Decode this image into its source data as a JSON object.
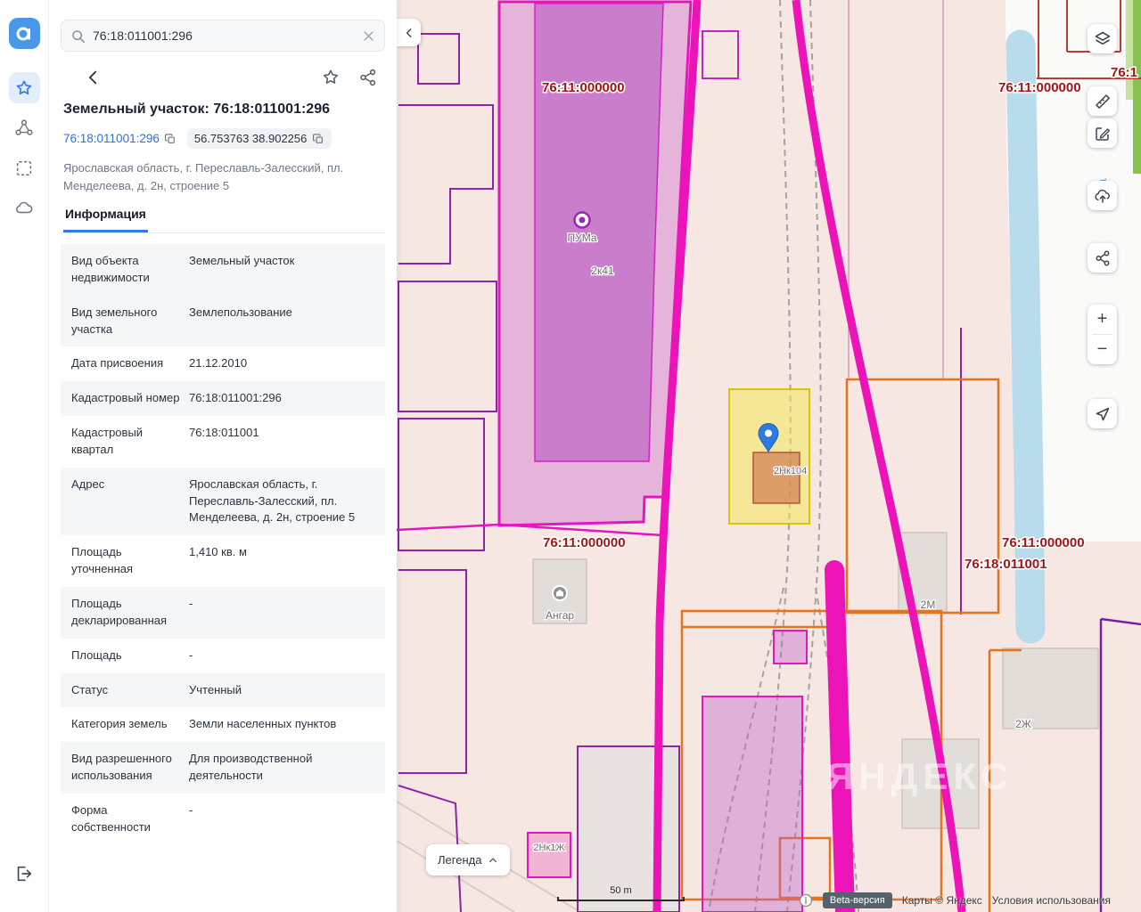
{
  "search": {
    "value": "76:18:011001:296"
  },
  "object": {
    "title": "Земельный участок: 76:18:011001:296",
    "cadastral_number_link": "76:18:011001:296",
    "coordinates": "56.753763 38.902256",
    "address": "Ярославская область, г. Переславль-Залесский, пл. Менделеева, д. 2н, строение 5",
    "tab": "Информация",
    "rows": [
      {
        "label": "Вид объекта недвижимости",
        "value": "Земельный участок"
      },
      {
        "label": "Вид земельного участка",
        "value": "Землепользование"
      },
      {
        "label": "Дата присвоения",
        "value": "21.12.2010"
      },
      {
        "label": "Кадастровый номер",
        "value": "76:18:011001:296"
      },
      {
        "label": "Кадастровый квартал",
        "value": "76:18:011001"
      },
      {
        "label": "Адрес",
        "value": "Ярославская область, г. Переславль-Залесский, пл. Менделеева, д. 2н, строение 5"
      },
      {
        "label": "Площадь уточненная",
        "value": "1,410 кв. м"
      },
      {
        "label": "Площадь декларированная",
        "value": "-"
      },
      {
        "label": "Площадь",
        "value": "-"
      },
      {
        "label": "Статус",
        "value": "Учтенный"
      },
      {
        "label": "Категория земель",
        "value": "Земли населенных пунктов"
      },
      {
        "label": "Вид разрешенного использования",
        "value": "Для производственной деятельности"
      },
      {
        "label": "Форма собственности",
        "value": "-"
      }
    ]
  },
  "map": {
    "quarter_labels": {
      "top_left": "76:11:000000",
      "top_right": "76:11:000000",
      "top_far": "76:1",
      "bottom_left": "76:11:000000",
      "bottom_right": "76:11:000000",
      "parcel": "76:18:011001"
    },
    "object_labels": {
      "puma": "ПУМа",
      "b2k41": "2к41",
      "angar": "Ангар",
      "b2m": "2М",
      "b2zh": "2Ж",
      "b2nk104": "2Нк104",
      "b2nk1zh": "2Нк1Ж"
    },
    "river_label": "тянк",
    "watermark": "ЯНДЕКС",
    "legend": "Легенда",
    "scale": "50 m",
    "zoom_in": "+",
    "zoom_out": "−",
    "beta": "Beta-версия",
    "copyright": "Карты © Яндекс",
    "terms": "Условия использования",
    "colors": {
      "highlight_parcel": "#f6e858",
      "boundary_magenta": "#ec13b8",
      "boundary_orange": "#e8731a",
      "quarter_label_red": "#a31515",
      "accent_blue": "#2f7ae5"
    }
  },
  "icons": {
    "sidebar": [
      "app-logo",
      "star",
      "share-nodes",
      "select-area",
      "cloud",
      "logout"
    ],
    "panel": [
      "search",
      "clear",
      "back",
      "star-outline",
      "share",
      "copy"
    ],
    "map_controls": [
      "layers",
      "measure",
      "edit",
      "upload",
      "share",
      "zoom-in",
      "zoom-out",
      "locate",
      "collapse-panel",
      "legend",
      "info"
    ]
  }
}
